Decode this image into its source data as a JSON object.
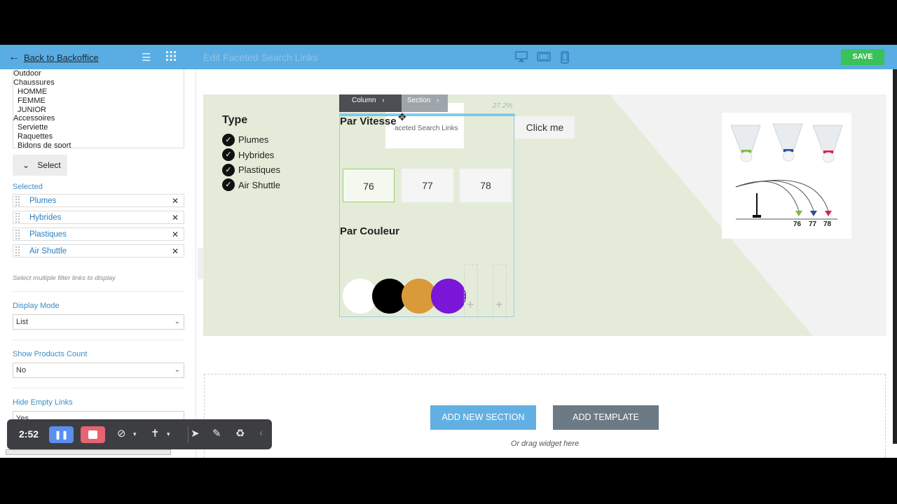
{
  "topbar": {
    "back_label": "Back to Backoffice",
    "title": "Edit Faceted Search Links",
    "save_label": "SAVE"
  },
  "panel": {
    "category_list": [
      "Outdoor",
      "Chaussures",
      "HOMME",
      "FEMME",
      "JUNIOR",
      "Accessoires",
      "Serviette",
      "Raquettes",
      "Bidons de sport"
    ],
    "select_button": "Select",
    "selected_label": "Selected",
    "selected_items": [
      "Plumes",
      "Hybrides",
      "Plastiques",
      "Air Shuttle"
    ],
    "hint": "Select multiple filter links to display",
    "display_mode_label": "Display Mode",
    "display_mode_value": "List",
    "show_count_label": "Show Products Count",
    "show_count_value": "No",
    "hide_empty_label": "Hide Empty Links",
    "hide_empty_value": "Yes"
  },
  "canvas": {
    "type_title": "Type",
    "type_items": [
      "Plumes",
      "Hybrides",
      "Plastiques",
      "Air Shuttle"
    ],
    "tab_column": "Column",
    "tab_section": "Section",
    "width_pct": "27.2%",
    "tooltip_text": "aceted Search Links",
    "vitesse_title": "Par Vitesse",
    "speeds": [
      "76",
      "77",
      "78"
    ],
    "couleur_title": "Par Couleur",
    "colors": [
      "#ffffff",
      "#000000",
      "#d99a3a",
      "#7a17d8"
    ],
    "click_me": "Click me",
    "image_labels": [
      "76",
      "77",
      "78"
    ]
  },
  "bottom": {
    "add_section": "ADD NEW SECTION",
    "add_template": "ADD TEMPLATE",
    "drag_hint": "Or drag widget here"
  },
  "recorder": {
    "time": "2:52"
  }
}
